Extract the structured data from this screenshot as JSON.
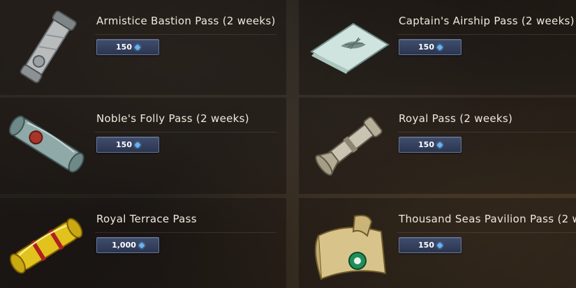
{
  "items": [
    {
      "name": "Armistice Bastion Pass (2 weeks)",
      "price": "150",
      "icon": "scroll-metal-icon"
    },
    {
      "name": "Captain's Airship Pass (2 weeks)",
      "price": "150",
      "icon": "map-ticket-icon"
    },
    {
      "name": "Noble's Folly Pass (2 weeks)",
      "price": "150",
      "icon": "scroll-sealed-icon"
    },
    {
      "name": "Royal Pass (2 weeks)",
      "price": "150",
      "icon": "scroll-case-icon"
    },
    {
      "name": "Royal Terrace Pass",
      "price": "1,000",
      "icon": "golden-scroll-icon"
    },
    {
      "name": "Thousand Seas Pavilion Pass (2 w",
      "price": "150",
      "icon": "parchment-seal-icon"
    }
  ],
  "currency_icon": "gem-icon",
  "colors": {
    "price_button": "#2f3a55",
    "gem": "#5fb6ff",
    "text": "#efe9de"
  }
}
